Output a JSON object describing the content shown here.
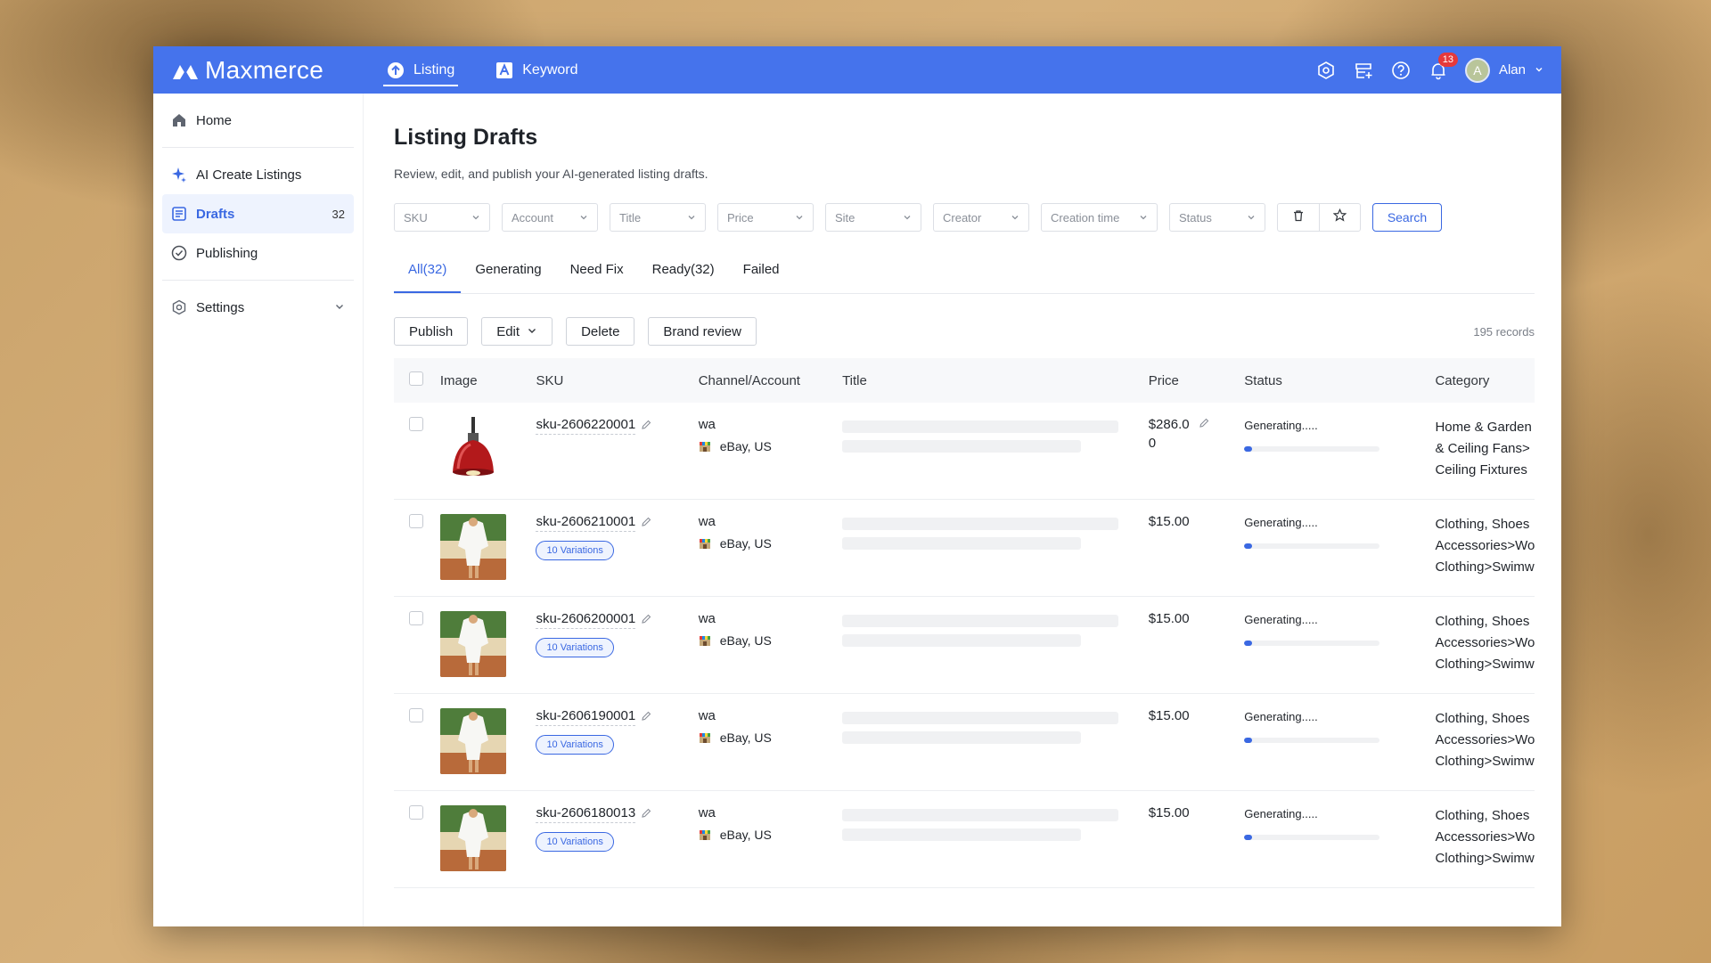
{
  "brand": {
    "name": "Maxmerce"
  },
  "topnav": [
    {
      "label": "Listing",
      "icon": "upload-circle-icon",
      "active": true
    },
    {
      "label": "Keyword",
      "icon": "keyword-a-icon",
      "active": false
    }
  ],
  "topbar": {
    "notification_count": "13",
    "user_initial": "A",
    "user_name": "Alan"
  },
  "sidebar": {
    "items": [
      {
        "label": "Home",
        "icon": "home-icon"
      },
      {
        "label": "AI Create Listings",
        "icon": "sparkle-icon"
      },
      {
        "label": "Drafts",
        "icon": "drafts-icon",
        "count": "32",
        "active": true
      },
      {
        "label": "Publishing",
        "icon": "check-circle-icon"
      },
      {
        "label": "Settings",
        "icon": "settings-icon"
      }
    ]
  },
  "page": {
    "title": "Listing Drafts",
    "subtitle": "Review, edit, and publish your AI-generated listing drafts."
  },
  "filters": [
    {
      "placeholder": "SKU"
    },
    {
      "placeholder": "Account"
    },
    {
      "placeholder": "Title"
    },
    {
      "placeholder": "Price"
    },
    {
      "placeholder": "Site"
    },
    {
      "placeholder": "Creator"
    },
    {
      "placeholder": "Creation time"
    },
    {
      "placeholder": "Status"
    }
  ],
  "search_label": "Search",
  "tabs": [
    {
      "label": "All(32)",
      "active": true
    },
    {
      "label": "Generating"
    },
    {
      "label": "Need Fix"
    },
    {
      "label": "Ready(32)"
    },
    {
      "label": "Failed"
    }
  ],
  "actions": {
    "publish": "Publish",
    "edit": "Edit",
    "delete": "Delete",
    "brand_review": "Brand review",
    "records": "195 records"
  },
  "table": {
    "headers": {
      "image": "Image",
      "sku": "SKU",
      "channel": "Channel/Account",
      "title": "Title",
      "price": "Price",
      "status": "Status",
      "category": "Category"
    },
    "rows": [
      {
        "image": "red-pendant-lamp",
        "sku": "sku-2606220001",
        "variations": "",
        "account": "wa",
        "site": "eBay, US",
        "price": "$286.0",
        "price2": "0",
        "status": "Generating.....",
        "progress": 0.06,
        "cat": [
          "Home & Garden",
          "& Ceiling Fans>",
          "Ceiling Fixtures"
        ]
      },
      {
        "image": "white-shirt-model",
        "sku": "sku-2606210001",
        "variations": "10 Variations",
        "account": "wa",
        "site": "eBay, US",
        "price": "$15.00",
        "price2": "",
        "status": "Generating.....",
        "progress": 0.06,
        "cat": [
          "Clothing, Shoes",
          "Accessories>Wo",
          "Clothing>Swimw"
        ]
      },
      {
        "image": "white-shirt-model",
        "sku": "sku-2606200001",
        "variations": "10 Variations",
        "account": "wa",
        "site": "eBay, US",
        "price": "$15.00",
        "price2": "",
        "status": "Generating.....",
        "progress": 0.06,
        "cat": [
          "Clothing, Shoes",
          "Accessories>Wo",
          "Clothing>Swimw"
        ]
      },
      {
        "image": "white-shirt-model",
        "sku": "sku-2606190001",
        "variations": "10 Variations",
        "account": "wa",
        "site": "eBay, US",
        "price": "$15.00",
        "price2": "",
        "status": "Generating.....",
        "progress": 0.06,
        "cat": [
          "Clothing, Shoes",
          "Accessories>Wo",
          "Clothing>Swimw"
        ]
      },
      {
        "image": "white-shirt-model",
        "sku": "sku-2606180013",
        "variations": "10 Variations",
        "account": "wa",
        "site": "eBay, US",
        "price": "$15.00",
        "price2": "",
        "status": "Generating.....",
        "progress": 0.06,
        "cat": [
          "Clothing, Shoes",
          "Accessories>Wo",
          "Clothing>Swimw"
        ]
      }
    ]
  },
  "colors": {
    "accent": "#3a68e2",
    "topbar": "#4573ec",
    "badge": "#e5393b"
  }
}
